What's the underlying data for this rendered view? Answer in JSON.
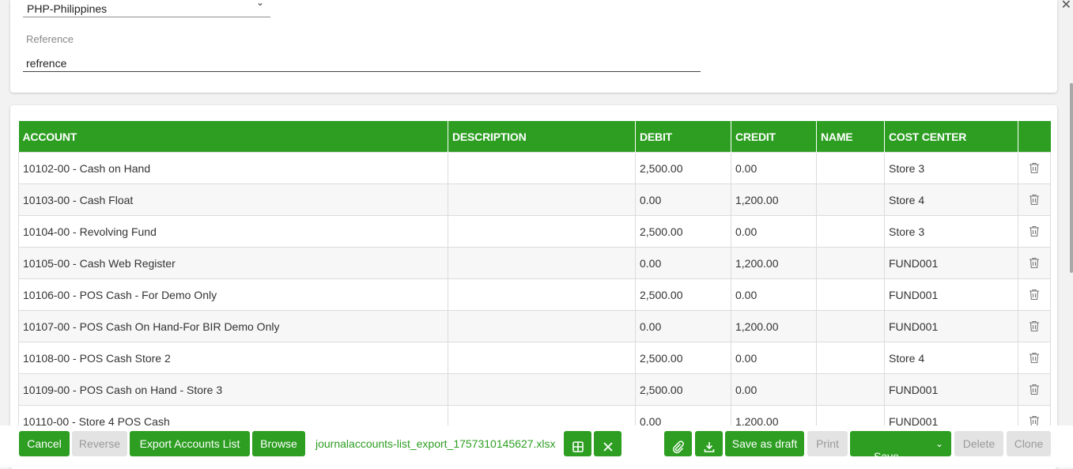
{
  "form": {
    "currency_value": "PHP-Philippines",
    "reference_label": "Reference",
    "reference_value": "refrence"
  },
  "table": {
    "headers": [
      "ACCOUNT",
      "DESCRIPTION",
      "DEBIT",
      "CREDIT",
      "NAME",
      "COST CENTER",
      ""
    ],
    "rows": [
      {
        "account": "10102-00 - Cash on Hand",
        "description": "",
        "debit": "2,500.00",
        "credit": "0.00",
        "name": "",
        "cost_center": "Store 3"
      },
      {
        "account": "10103-00 - Cash Float",
        "description": "",
        "debit": "0.00",
        "credit": "1,200.00",
        "name": "",
        "cost_center": "Store 4"
      },
      {
        "account": "10104-00 - Revolving Fund",
        "description": "",
        "debit": "2,500.00",
        "credit": "0.00",
        "name": "",
        "cost_center": "Store 3"
      },
      {
        "account": "10105-00 - Cash Web Register",
        "description": "",
        "debit": "0.00",
        "credit": "1,200.00",
        "name": "",
        "cost_center": "FUND001"
      },
      {
        "account": "10106-00 - POS Cash - For Demo Only",
        "description": "",
        "debit": "2,500.00",
        "credit": "0.00",
        "name": "",
        "cost_center": "FUND001"
      },
      {
        "account": "10107-00 - POS Cash On Hand-For BIR Demo Only",
        "description": "",
        "debit": "0.00",
        "credit": "1,200.00",
        "name": "",
        "cost_center": "FUND001"
      },
      {
        "account": "10108-00 - POS Cash Store 2",
        "description": "",
        "debit": "2,500.00",
        "credit": "0.00",
        "name": "",
        "cost_center": "Store 4"
      },
      {
        "account": "10109-00 - POS Cash on Hand - Store 3",
        "description": "",
        "debit": "2,500.00",
        "credit": "0.00",
        "name": "",
        "cost_center": "FUND001"
      },
      {
        "account": "10110-00 - Store 4 POS Cash",
        "description": "",
        "debit": "0.00",
        "credit": "1,200.00",
        "name": "",
        "cost_center": "FUND001"
      }
    ]
  },
  "actions": {
    "cancel": "Cancel",
    "reverse": "Reverse",
    "export": "Export Accounts List",
    "browse": "Browse",
    "file_name": "journalaccounts-list_export_1757310145627.xlsx",
    "save_draft": "Save as draft",
    "print": "Print",
    "save": "Save",
    "delete": "Delete",
    "clone": "Clone"
  },
  "colors": {
    "accent": "#2d9e22",
    "disabled_bg": "#e3e3e3",
    "disabled_text": "#9a9a9a"
  },
  "icons": [
    "close-icon",
    "chevron-down-icon",
    "trash-icon",
    "grid-icon",
    "clear-icon",
    "paperclip-icon",
    "download-icon"
  ]
}
